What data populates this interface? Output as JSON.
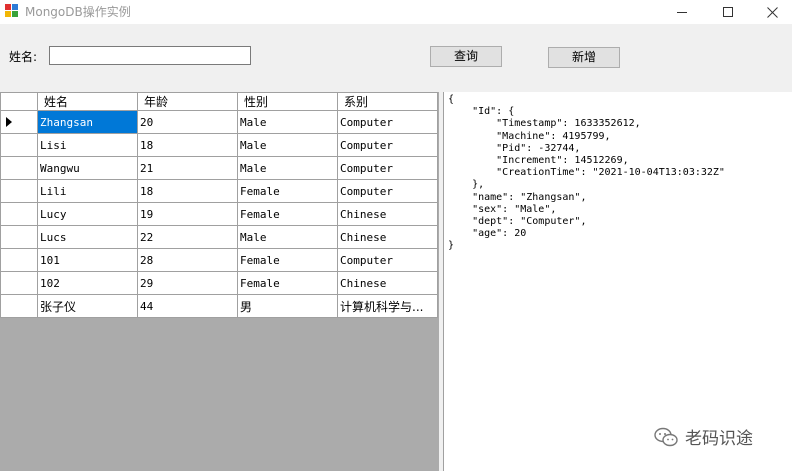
{
  "window": {
    "title": "MongoDB操作实例",
    "minimize_glyph": "—",
    "maximize_glyph": "☐",
    "close_glyph": "✕"
  },
  "search": {
    "label": "姓名:",
    "value": "",
    "query_button": "查询",
    "add_button": "新增"
  },
  "grid": {
    "columns": [
      "姓名",
      "年龄",
      "性别",
      "系别"
    ],
    "selected_row": 0,
    "rows": [
      [
        "Zhangsan",
        "20",
        "Male",
        "Computer"
      ],
      [
        "Lisi",
        "18",
        "Male",
        "Computer"
      ],
      [
        "Wangwu",
        "21",
        "Male",
        "Computer"
      ],
      [
        "Lili",
        "18",
        "Female",
        "Computer"
      ],
      [
        "Lucy",
        "19",
        "Female",
        "Chinese"
      ],
      [
        "Lucs",
        "22",
        "Male",
        "Chinese"
      ],
      [
        "101",
        "28",
        "Female",
        "Computer"
      ],
      [
        "102",
        "29",
        "Female",
        "Chinese"
      ],
      [
        "张子仪",
        "44",
        "男",
        "计算机科学与..."
      ]
    ]
  },
  "json_panel": {
    "text": "{\n    \"Id\": {\n        \"Timestamp\": 1633352612,\n        \"Machine\": 4195799,\n        \"Pid\": -32744,\n        \"Increment\": 14512269,\n        \"CreationTime\": \"2021-10-04T13:03:32Z\"\n    },\n    \"name\": \"Zhangsan\",\n    \"sex\": \"Male\",\n    \"dept\": \"Computer\",\n    \"age\": 20\n}"
  },
  "watermark": {
    "text": "老码识途"
  },
  "colors": {
    "selection": "#0078d7",
    "grid_background": "#ababab",
    "window_background": "#f0f0f0"
  }
}
